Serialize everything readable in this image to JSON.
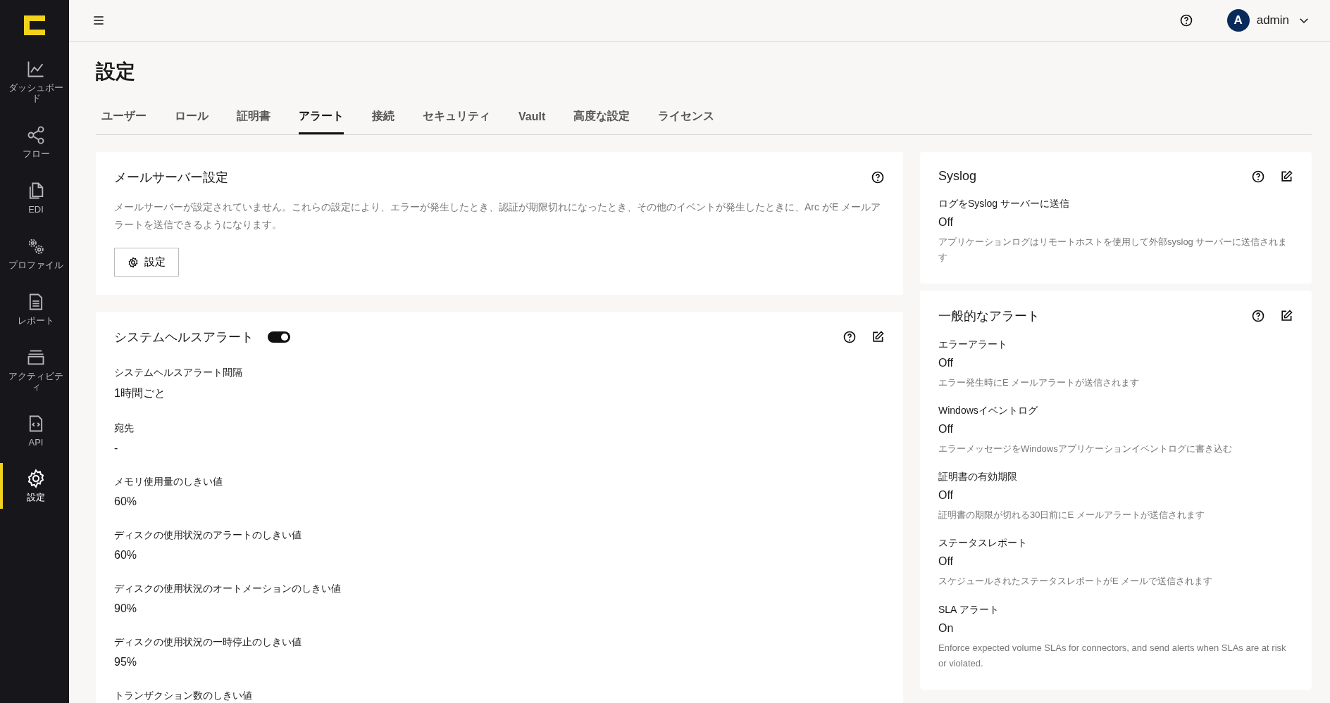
{
  "sidebar": {
    "items": [
      {
        "label": "ダッシュボード",
        "selected": false
      },
      {
        "label": "フロー",
        "selected": false
      },
      {
        "label": "EDI",
        "selected": false
      },
      {
        "label": "プロファイル",
        "selected": false
      },
      {
        "label": "レポート",
        "selected": false
      },
      {
        "label": "アクティビティ",
        "selected": false
      },
      {
        "label": "API",
        "selected": false
      },
      {
        "label": "設定",
        "selected": true
      }
    ]
  },
  "topbar": {
    "avatar": "A",
    "user": "admin"
  },
  "page_title": "設定",
  "tabs": [
    {
      "label": "ユーザー",
      "selected": false
    },
    {
      "label": "ロール",
      "selected": false
    },
    {
      "label": "証明書",
      "selected": false
    },
    {
      "label": "アラート",
      "selected": true
    },
    {
      "label": "接続",
      "selected": false
    },
    {
      "label": "セキュリティ",
      "selected": false
    },
    {
      "label": "Vault",
      "selected": false
    },
    {
      "label": "高度な設定",
      "selected": false
    },
    {
      "label": "ライセンス",
      "selected": false
    }
  ],
  "mail_server": {
    "title": "メールサーバー設定",
    "description": "メールサーバーが設定されていません。これらの設定により、エラーが発生したとき、認証が期限切れになったとき、その他のイベントが発生したときに、Arc がE メールアラートを送信できるようになります。",
    "button": "設定"
  },
  "system_health": {
    "title": "システムヘルスアラート",
    "on": true,
    "fields": [
      {
        "label": "システムヘルスアラート間隔",
        "value": "1時間ごと"
      },
      {
        "label": "宛先",
        "value": "-"
      },
      {
        "label": "メモリ使用量のしきい値",
        "value": "60%"
      },
      {
        "label": "ディスクの使用状況のアラートのしきい値",
        "value": "60%"
      },
      {
        "label": "ディスクの使用状況のオートメーションのしきい値",
        "value": "90%"
      },
      {
        "label": "ディスクの使用状況の一時停止のしきい値",
        "value": "95%"
      },
      {
        "label": "トランザクション数のしきい値"
      }
    ]
  },
  "syslog": {
    "title": "Syslog",
    "fields": [
      {
        "label": "ログをSyslog サーバーに送信",
        "value": "Off",
        "description": "アプリケーションログはリモートホストを使用して外部syslog サーバーに送信されます"
      }
    ]
  },
  "general_alerts": {
    "title": "一般的なアラート",
    "fields": [
      {
        "label": "エラーアラート",
        "value": "Off",
        "description": "エラー発生時にE メールアラートが送信されます"
      },
      {
        "label": "Windowsイベントログ",
        "value": "Off",
        "description": "エラーメッセージをWindowsアプリケーションイベントログに書き込む"
      },
      {
        "label": "証明書の有効期限",
        "value": "Off",
        "description": "証明書の期限が切れる30日前にE メールアラートが送信されます"
      },
      {
        "label": "ステータスレポート",
        "value": "Off",
        "description": "スケジュールされたステータスレポートがE メールで送信されます"
      },
      {
        "label": "SLA アラート",
        "value": "On",
        "description": "Enforce expected volume SLAs for connectors, and send alerts when SLAs are at risk or violated."
      }
    ]
  }
}
